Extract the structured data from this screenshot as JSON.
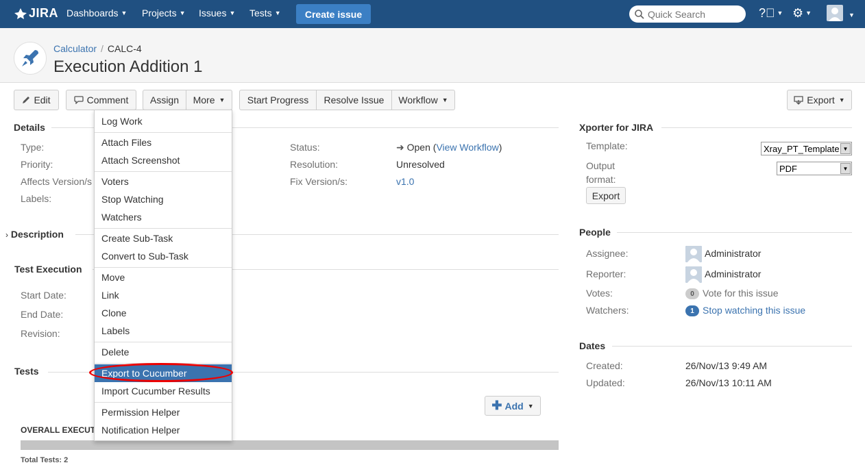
{
  "nav": {
    "logo": "JIRA",
    "items": [
      "Dashboards",
      "Projects",
      "Issues",
      "Tests"
    ],
    "create_issue": "Create issue",
    "search_placeholder": "Quick Search"
  },
  "header": {
    "project": "Calculator",
    "issue_key": "CALC-4",
    "title": "Execution Addition 1"
  },
  "toolbar": {
    "edit": "Edit",
    "comment": "Comment",
    "assign": "Assign",
    "more": "More",
    "start_progress": "Start Progress",
    "resolve_issue": "Resolve Issue",
    "workflow": "Workflow",
    "export": "Export"
  },
  "more_menu": {
    "items": [
      "Log Work",
      "Attach Files",
      "Attach Screenshot",
      "Voters",
      "Stop Watching",
      "Watchers",
      "Create Sub-Task",
      "Convert to Sub-Task",
      "Move",
      "Link",
      "Clone",
      "Labels",
      "Delete",
      "Export to Cucumber",
      "Import Cucumber Results",
      "Permission Helper",
      "Notification Helper"
    ],
    "highlighted": "Export to Cucumber"
  },
  "details": {
    "heading": "Details",
    "type_label": "Type:",
    "priority_label": "Priority:",
    "affects_label": "Affects Version/s",
    "labels_label": "Labels:",
    "status_label": "Status:",
    "status_value": "Open",
    "view_workflow": "View Workflow",
    "resolution_label": "Resolution:",
    "resolution_value": "Unresolved",
    "fix_label": "Fix Version/s:",
    "fix_value": "v1.0"
  },
  "description": {
    "heading": "Description"
  },
  "test_execution": {
    "heading": "Test Execution",
    "start_date": "Start Date:",
    "end_date": "End Date:",
    "revision": "Revision:"
  },
  "tests": {
    "heading": "Tests",
    "add": "Add",
    "overall": "OVERALL EXECUTIC",
    "total": "Total Tests: 2"
  },
  "xporter": {
    "heading": "Xporter for JIRA",
    "template_label": "Template:",
    "template_value": "Xray_PT_Template",
    "output_label_1": "Output",
    "output_label_2": "format:",
    "output_value": "PDF",
    "export_button": "Export"
  },
  "people": {
    "heading": "People",
    "assignee_label": "Assignee:",
    "assignee": "Administrator",
    "reporter_label": "Reporter:",
    "reporter": "Administrator",
    "votes_label": "Votes:",
    "votes_count": "0",
    "vote_link": "Vote for this issue",
    "watchers_label": "Watchers:",
    "watchers_count": "1",
    "watch_link": "Stop watching this issue"
  },
  "dates": {
    "heading": "Dates",
    "created_label": "Created:",
    "created": "26/Nov/13 9:49 AM",
    "updated_label": "Updated:",
    "updated": "26/Nov/13 10:11 AM"
  }
}
